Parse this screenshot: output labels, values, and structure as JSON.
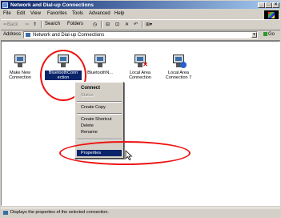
{
  "window": {
    "title": "Network and Dial-up Connections"
  },
  "title_buttons": {
    "minimize": "_",
    "maximize": "□",
    "close": "×"
  },
  "menu": [
    "File",
    "Edit",
    "View",
    "Favorites",
    "Tools",
    "Advanced",
    "Help"
  ],
  "toolbar": {
    "back": "⇐Back",
    "forward": "⇒",
    "up": "⇑",
    "search": "Search",
    "folders": "Folders",
    "history": "◷",
    "move": "⊟",
    "copy": "⊡",
    "delete": "✕",
    "undo": "↶",
    "views": "⊞▾"
  },
  "address": {
    "label": "Address",
    "value": "Network and Dial-up Connections",
    "go": "Go"
  },
  "connections": [
    {
      "label": "Make New Connection",
      "selected": false
    },
    {
      "label": "BluetoothConn ection",
      "selected": true
    },
    {
      "label": "BluetoothN...",
      "selected": false
    },
    {
      "label": "Local Area Connection",
      "selected": false
    },
    {
      "label": "Local Area Connection 7",
      "selected": false
    }
  ],
  "context_menu": {
    "items": [
      {
        "label": "Connect",
        "style": "bold"
      },
      {
        "label": "Status",
        "style": "disabled"
      },
      {
        "label": "Create Copy",
        "style": "normal"
      },
      {
        "label": "Create Shortcut",
        "style": "normal"
      },
      {
        "label": "Delete",
        "style": "normal"
      },
      {
        "label": "Rename",
        "style": "normal"
      },
      {
        "label": "Properties",
        "style": "highlighted"
      }
    ]
  },
  "status_bar": {
    "text": "Displays the properties of the selected connection."
  },
  "colors": {
    "selection": "#0a246a",
    "annotation": "#e11111",
    "window_bg": "#d4d0c8"
  }
}
